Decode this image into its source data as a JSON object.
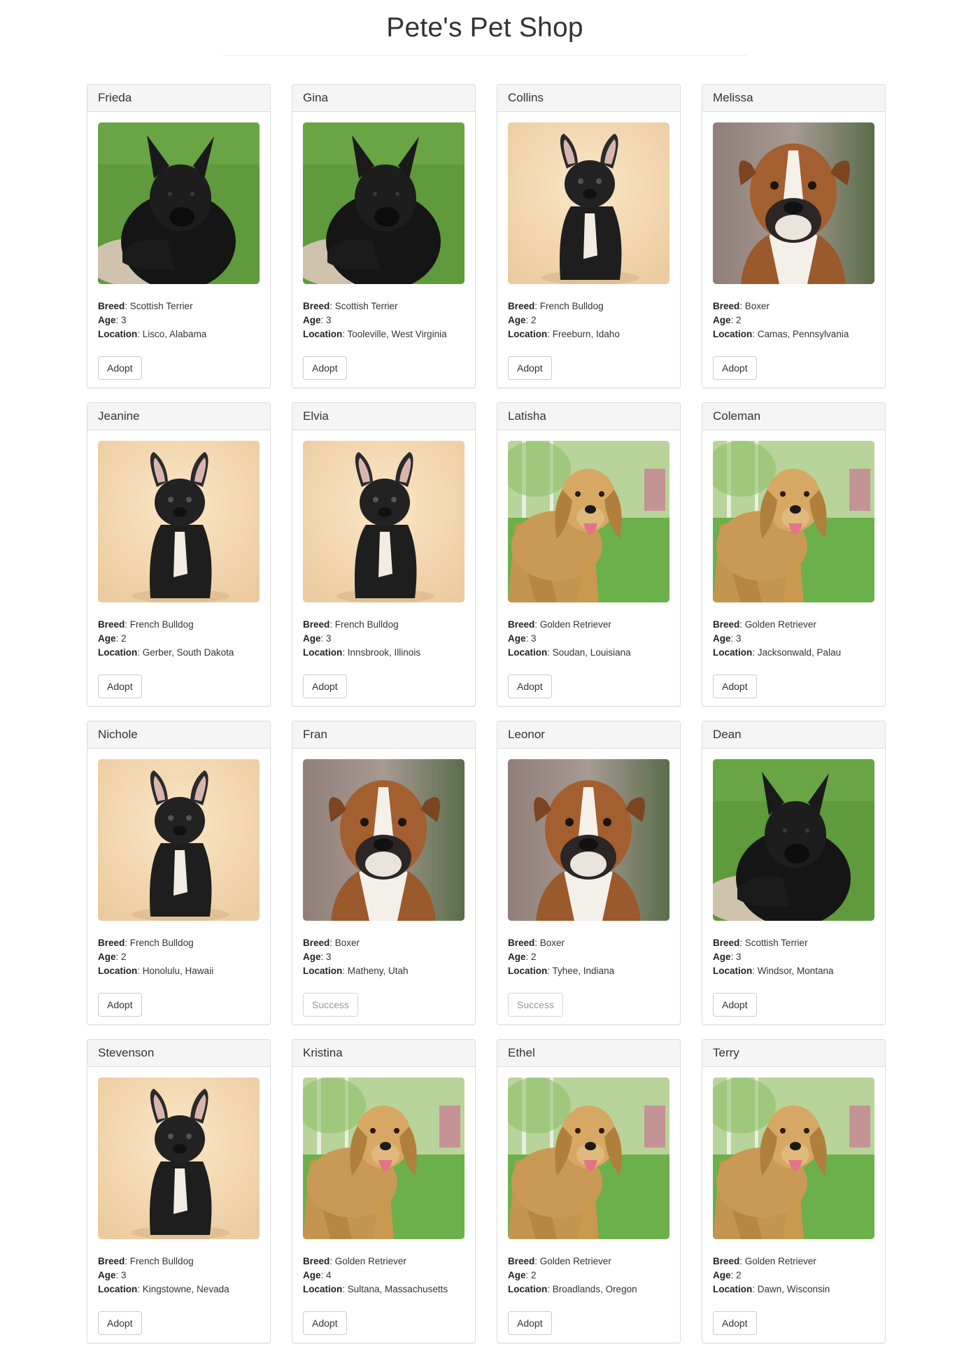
{
  "page": {
    "title": "Pete's Pet Shop"
  },
  "pets": [
    {
      "name": "Frieda",
      "breed_label": "Breed",
      "breed": "Scottish Terrier",
      "age_label": "Age",
      "age": "3",
      "location_label": "Location",
      "location": "Lisco, Alabama",
      "photo": "scottish-terrier",
      "button": "Adopt",
      "button_enabled": true
    },
    {
      "name": "Gina",
      "breed_label": "Breed",
      "breed": "Scottish Terrier",
      "age_label": "Age",
      "age": "3",
      "location_label": "Location",
      "location": "Tooleville, West Virginia",
      "photo": "scottish-terrier",
      "button": "Adopt",
      "button_enabled": true
    },
    {
      "name": "Collins",
      "breed_label": "Breed",
      "breed": "French Bulldog",
      "age_label": "Age",
      "age": "2",
      "location_label": "Location",
      "location": "Freeburn, Idaho",
      "photo": "french-bulldog",
      "button": "Adopt",
      "button_enabled": true
    },
    {
      "name": "Melissa",
      "breed_label": "Breed",
      "breed": "Boxer",
      "age_label": "Age",
      "age": "2",
      "location_label": "Location",
      "location": "Camas, Pennsylvania",
      "photo": "boxer",
      "button": "Adopt",
      "button_enabled": true
    },
    {
      "name": "Jeanine",
      "breed_label": "Breed",
      "breed": "French Bulldog",
      "age_label": "Age",
      "age": "2",
      "location_label": "Location",
      "location": "Gerber, South Dakota",
      "photo": "french-bulldog",
      "button": "Adopt",
      "button_enabled": true
    },
    {
      "name": "Elvia",
      "breed_label": "Breed",
      "breed": "French Bulldog",
      "age_label": "Age",
      "age": "3",
      "location_label": "Location",
      "location": "Innsbrook, Illinois",
      "photo": "french-bulldog",
      "button": "Adopt",
      "button_enabled": true
    },
    {
      "name": "Latisha",
      "breed_label": "Breed",
      "breed": "Golden Retriever",
      "age_label": "Age",
      "age": "3",
      "location_label": "Location",
      "location": "Soudan, Louisiana",
      "photo": "golden-retriever",
      "button": "Adopt",
      "button_enabled": true
    },
    {
      "name": "Coleman",
      "breed_label": "Breed",
      "breed": "Golden Retriever",
      "age_label": "Age",
      "age": "3",
      "location_label": "Location",
      "location": "Jacksonwald, Palau",
      "photo": "golden-retriever",
      "button": "Adopt",
      "button_enabled": true
    },
    {
      "name": "Nichole",
      "breed_label": "Breed",
      "breed": "French Bulldog",
      "age_label": "Age",
      "age": "2",
      "location_label": "Location",
      "location": "Honolulu, Hawaii",
      "photo": "french-bulldog",
      "button": "Adopt",
      "button_enabled": true
    },
    {
      "name": "Fran",
      "breed_label": "Breed",
      "breed": "Boxer",
      "age_label": "Age",
      "age": "3",
      "location_label": "Location",
      "location": "Matheny, Utah",
      "photo": "boxer",
      "button": "Success",
      "button_enabled": false
    },
    {
      "name": "Leonor",
      "breed_label": "Breed",
      "breed": "Boxer",
      "age_label": "Age",
      "age": "2",
      "location_label": "Location",
      "location": "Tyhee, Indiana",
      "photo": "boxer",
      "button": "Success",
      "button_enabled": false
    },
    {
      "name": "Dean",
      "breed_label": "Breed",
      "breed": "Scottish Terrier",
      "age_label": "Age",
      "age": "3",
      "location_label": "Location",
      "location": "Windsor, Montana",
      "photo": "scottish-terrier",
      "button": "Adopt",
      "button_enabled": true
    },
    {
      "name": "Stevenson",
      "breed_label": "Breed",
      "breed": "French Bulldog",
      "age_label": "Age",
      "age": "3",
      "location_label": "Location",
      "location": "Kingstowne, Nevada",
      "photo": "french-bulldog",
      "button": "Adopt",
      "button_enabled": true
    },
    {
      "name": "Kristina",
      "breed_label": "Breed",
      "breed": "Golden Retriever",
      "age_label": "Age",
      "age": "4",
      "location_label": "Location",
      "location": "Sultana, Massachusetts",
      "photo": "golden-retriever",
      "button": "Adopt",
      "button_enabled": true
    },
    {
      "name": "Ethel",
      "breed_label": "Breed",
      "breed": "Golden Retriever",
      "age_label": "Age",
      "age": "2",
      "location_label": "Location",
      "location": "Broadlands, Oregon",
      "photo": "golden-retriever",
      "button": "Adopt",
      "button_enabled": true
    },
    {
      "name": "Terry",
      "breed_label": "Breed",
      "breed": "Golden Retriever",
      "age_label": "Age",
      "age": "2",
      "location_label": "Location",
      "location": "Dawn, Wisconsin",
      "photo": "golden-retriever",
      "button": "Adopt",
      "button_enabled": true
    }
  ]
}
